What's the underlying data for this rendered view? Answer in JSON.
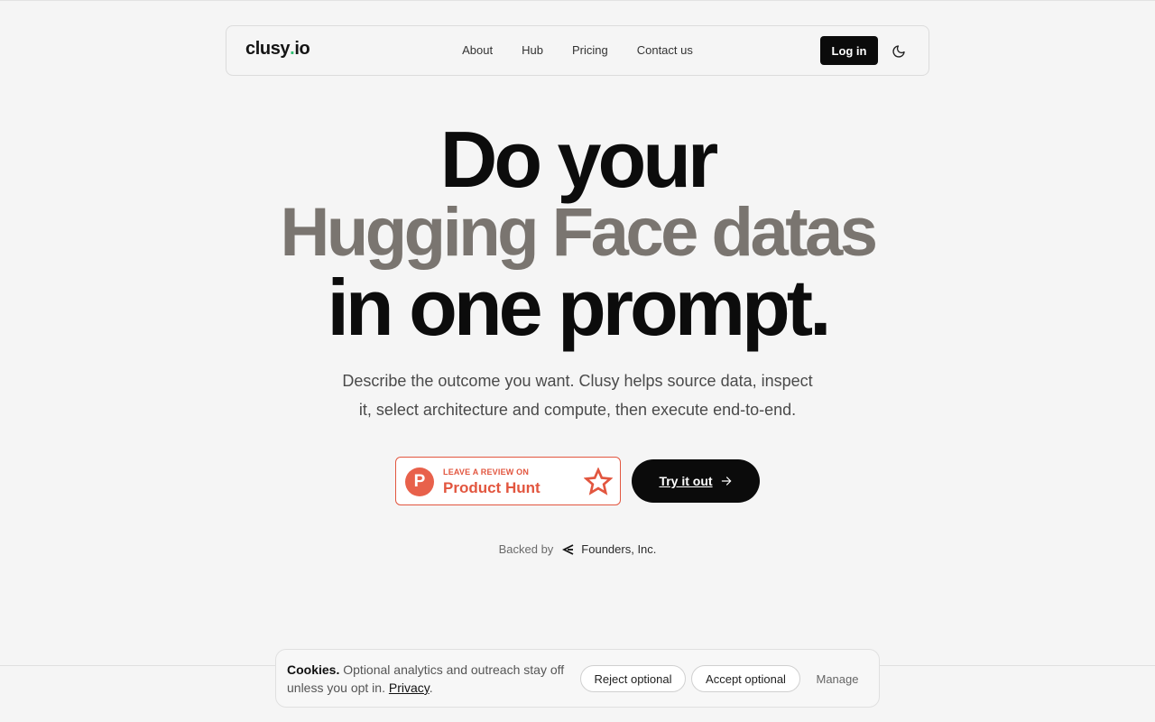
{
  "navbar": {
    "logo_main": "clusy",
    "logo_dot": ".",
    "logo_tld": "io",
    "links": [
      "About",
      "Hub",
      "Pricing",
      "Contact us"
    ],
    "login_label": "Log in",
    "theme_icon": "moon-icon"
  },
  "hero": {
    "line1": "Do your",
    "line2": "Hugging Face datas",
    "line3": "in one prompt.",
    "subtitle_1": "Describe the outcome you want. Clusy helps source data, inspect",
    "subtitle_2": "it, select architecture and compute, then execute end-to-end."
  },
  "cta": {
    "ph_small": "LEAVE A REVIEW ON",
    "ph_big": "Product Hunt",
    "ph_letter": "P",
    "try_label": "Try it out"
  },
  "backed": {
    "label": "Backed by",
    "company": "Founders, Inc."
  },
  "cookie": {
    "title": "Cookies.",
    "body": "Optional analytics and outreach stay off unless you opt in.",
    "privacy_link": "Privacy",
    "period": ".",
    "reject_label": "Reject optional",
    "accept_label": "Accept optional",
    "manage_label": "Manage"
  },
  "colors": {
    "background": "#f5f5f5",
    "accent_dark": "#0b0b0b",
    "hero_gray": "#7a7570",
    "product_hunt": "#e2563f",
    "logo_dot": "#2fbf71"
  }
}
